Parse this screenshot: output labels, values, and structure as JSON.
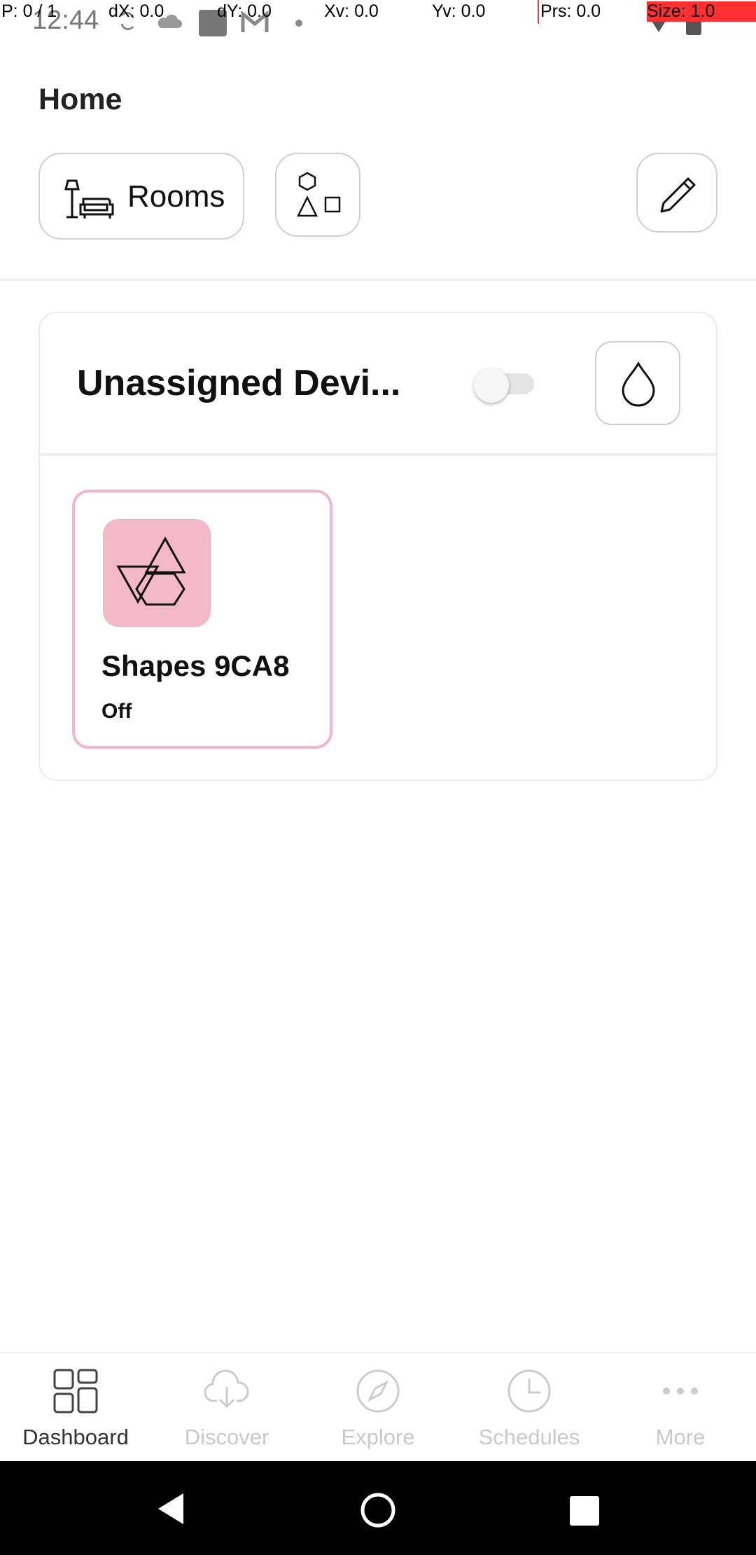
{
  "status_bar": {
    "time": "12:44"
  },
  "debug_overlay": {
    "p": "P: 0 / 1",
    "dx": "dX: 0.0",
    "dy": "dY: 0.0",
    "xv": "Xv: 0.0",
    "yv": "Yv: 0.0",
    "prs": "Prs: 0.0",
    "size": "Size: 1.0"
  },
  "header": {
    "title": "Home",
    "rooms_label": "Rooms"
  },
  "section": {
    "title": "Unassigned Devi...",
    "toggle_on": false
  },
  "device": {
    "name": "Shapes 9CA8",
    "state": "Off",
    "tile_color": "#f4b9c9",
    "border_color": "#f3b6c9"
  },
  "bottom_nav": {
    "items": [
      {
        "label": "Dashboard",
        "icon": "dashboard-icon",
        "active": true
      },
      {
        "label": "Discover",
        "icon": "download-icon",
        "active": false
      },
      {
        "label": "Explore",
        "icon": "compass-icon",
        "active": false
      },
      {
        "label": "Schedules",
        "icon": "clock-icon",
        "active": false
      },
      {
        "label": "More",
        "icon": "more-icon",
        "active": false
      }
    ]
  }
}
